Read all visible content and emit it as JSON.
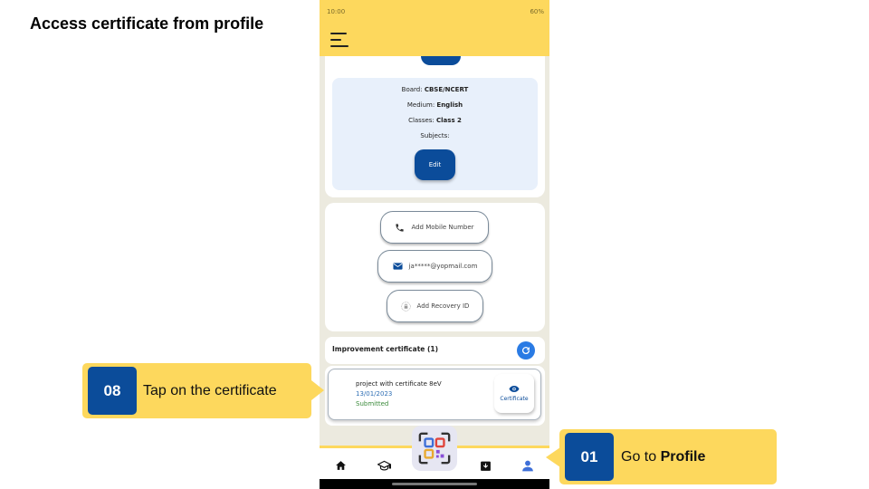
{
  "slide": {
    "title": "Access certificate from profile"
  },
  "status_bar": {
    "time": "10:00",
    "battery": "60%"
  },
  "profile": {
    "board_label": "Board: ",
    "board_value": "CBSE/NCERT",
    "medium_label": "Medium: ",
    "medium_value": "English",
    "classes_label": "Classes: ",
    "classes_value": "Class 2",
    "subjects_label": "Subjects:",
    "edit_label": "Edit"
  },
  "contact": {
    "mobile_label": "Add Mobile Number",
    "email_value": "ja*****@yopmail.com",
    "recovery_label": "Add Recovery ID"
  },
  "certificates": {
    "header": "Improvement certificate (1)",
    "items": [
      {
        "name": "project with certificate 8eV",
        "date": "13/01/2023",
        "status": "Submitted",
        "view_label": "Certificate"
      }
    ]
  },
  "bottom_nav": {
    "items": [
      "home-icon",
      "courses-icon",
      "qr-scanner-icon",
      "downloads-icon",
      "profile-icon"
    ]
  },
  "callouts": {
    "step8": {
      "number": "08",
      "text": "Tap on the certificate"
    },
    "step1": {
      "number": "01",
      "text_prefix": "Go to ",
      "text_bold": "Profile"
    }
  },
  "colors": {
    "accent_yellow": "#fdd85d",
    "primary_blue": "#0b4c9a",
    "phone_bg": "#eceadf",
    "info_bg": "#e8f0fb"
  }
}
